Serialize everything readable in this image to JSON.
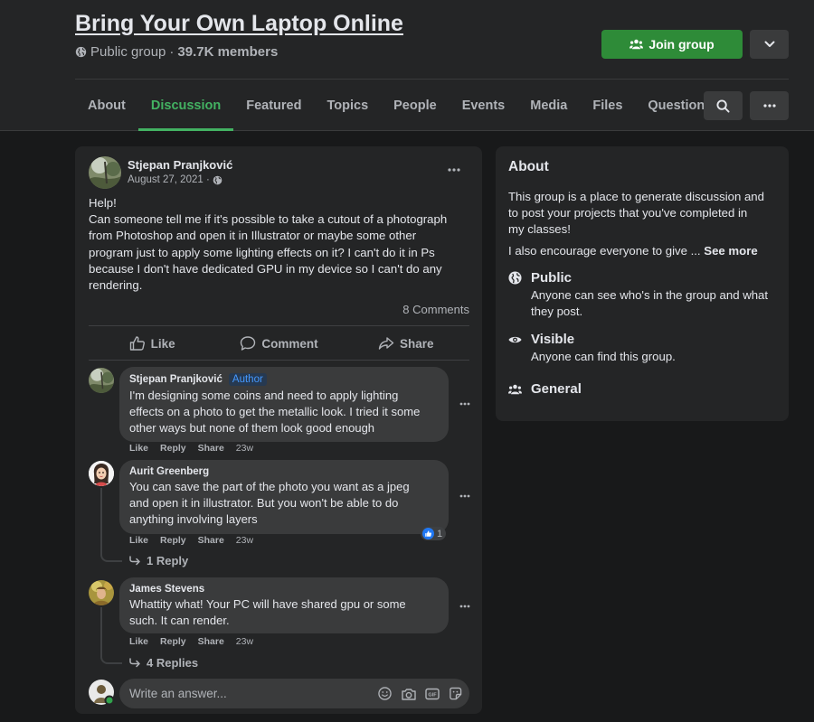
{
  "header": {
    "group_title": "Bring Your Own Laptop Online",
    "privacy": "Public group",
    "separator": "·",
    "members": "39.7K members",
    "join_label": "Join group",
    "tabs": [
      "About",
      "Discussion",
      "Featured",
      "Topics",
      "People",
      "Events",
      "Media",
      "Files",
      "Questions"
    ],
    "active_tab": "Discussion"
  },
  "post": {
    "author": "Stjepan Pranjković",
    "date": "August 27, 2021 ·",
    "lines": [
      "Help!",
      "Can someone tell me if it's possible to take a cutout of a photograph",
      "from Photoshop and open it in Illustrator or maybe some other",
      "program just to apply some lighting effects on it? I can't do it in Ps",
      "because I don't have dedicated GPU in my device so I can't do any",
      "rendering."
    ],
    "comments_count": "8 Comments",
    "actions": {
      "like": "Like",
      "comment": "Comment",
      "share": "Share"
    }
  },
  "comments": [
    {
      "name": "Stjepan Pranjković",
      "badge": "Author",
      "lines": [
        "I'm designing some coins and need to apply lighting",
        "effects on a photo to get the metallic look. I tried it some",
        "other ways but none of them look good enough"
      ],
      "like": "Like",
      "reply": "Reply",
      "share": "Share",
      "time": "23w"
    },
    {
      "name": "Aurit Greenberg",
      "lines": [
        "You can save the part of the photo you want as a jpeg",
        "and open it in illustrator. But you won't be able to do",
        "anything involving layers"
      ],
      "like": "Like",
      "reply": "Reply",
      "share": "Share",
      "time": "23w",
      "reaction_count": "1",
      "replies": "1 Reply"
    },
    {
      "name": "James Stevens",
      "lines": [
        "Whattity what! Your PC will have shared gpu or some",
        "such. It can render."
      ],
      "like": "Like",
      "reply": "Reply",
      "share": "Share",
      "time": "23w",
      "replies": "4 Replies"
    }
  ],
  "composer": {
    "placeholder": "Write an answer..."
  },
  "about": {
    "title": "About",
    "desc_lines": [
      "This group is a place to generate discussion and",
      "to post your projects that you've completed in",
      "my classes!"
    ],
    "more_text": "I also encourage everyone to give ...",
    "see_more": "See more",
    "items": [
      {
        "icon": "globe-icon",
        "title": "Public",
        "lines": [
          "Anyone can see who's in the group and what",
          "they post."
        ]
      },
      {
        "icon": "eye-icon",
        "title": "Visible",
        "lines": [
          "Anyone can find this group."
        ]
      },
      {
        "icon": "people-icon",
        "title": "General",
        "lines": []
      }
    ]
  },
  "colors": {
    "background": "#18191a",
    "card": "#242526",
    "accent_green": "#43b262",
    "join_button": "#2e8b38",
    "author_badge_text": "#4599ff"
  }
}
